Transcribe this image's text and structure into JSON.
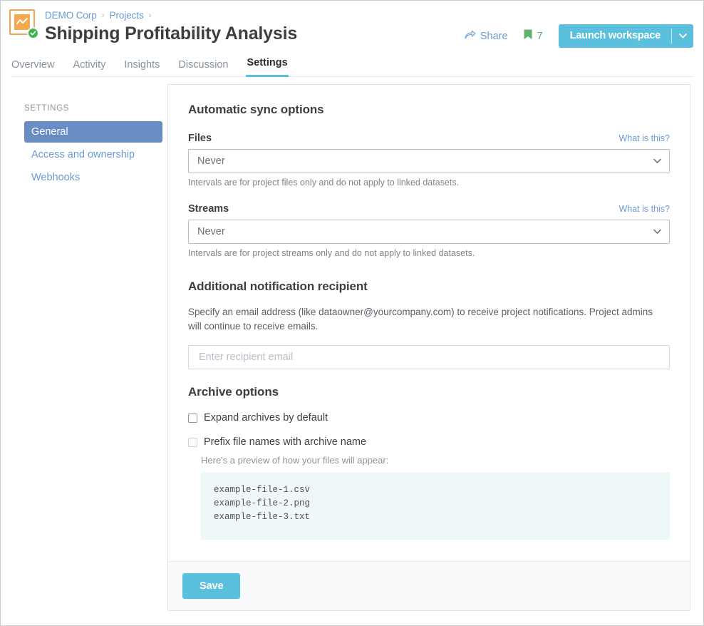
{
  "header": {
    "breadcrumb": [
      {
        "label": "DEMO Corp"
      },
      {
        "label": "Projects"
      }
    ],
    "breadcrumb_separator": "›",
    "title": "Shipping Profitability Analysis",
    "share_label": "Share",
    "bookmark_count": "7",
    "launch_label": "Launch workspace",
    "accent_color": "#5bc0de",
    "icon_color": "#f4a94e",
    "badge_color": "#3fb44f",
    "bookmark_color": "#5db36a"
  },
  "tabs": [
    {
      "label": "Overview",
      "active": false
    },
    {
      "label": "Activity",
      "active": false
    },
    {
      "label": "Insights",
      "active": false
    },
    {
      "label": "Discussion",
      "active": false
    },
    {
      "label": "Settings",
      "active": true
    }
  ],
  "sidebar": {
    "title": "SETTINGS",
    "items": [
      {
        "label": "General",
        "active": true
      },
      {
        "label": "Access and ownership",
        "active": false
      },
      {
        "label": "Webhooks",
        "active": false
      }
    ]
  },
  "main": {
    "sync_section": {
      "heading": "Automatic sync options",
      "files": {
        "label": "Files",
        "help_link": "What is this?",
        "value": "Never",
        "options": [
          "Never"
        ],
        "hint": "Intervals are for project files only and do not apply to linked datasets."
      },
      "streams": {
        "label": "Streams",
        "help_link": "What is this?",
        "value": "Never",
        "options": [
          "Never"
        ],
        "hint": "Intervals are for project streams only and do not apply to linked datasets."
      }
    },
    "notification_section": {
      "heading": "Additional notification recipient",
      "description": "Specify an email address (like dataowner@yourcompany.com) to receive project notifications. Project admins will continue to receive emails.",
      "input_value": "",
      "input_placeholder": "Enter recipient email"
    },
    "archive_section": {
      "heading": "Archive options",
      "expand_label": "Expand archives by default",
      "expand_checked": false,
      "prefix_label": "Prefix file names with archive name",
      "prefix_checked": false,
      "prefix_disabled": true,
      "preview_note": "Here's a preview of how your files will appear:",
      "preview_files": [
        "example-file-1.csv",
        "example-file-2.png",
        "example-file-3.txt"
      ]
    },
    "footer": {
      "save_label": "Save"
    }
  }
}
